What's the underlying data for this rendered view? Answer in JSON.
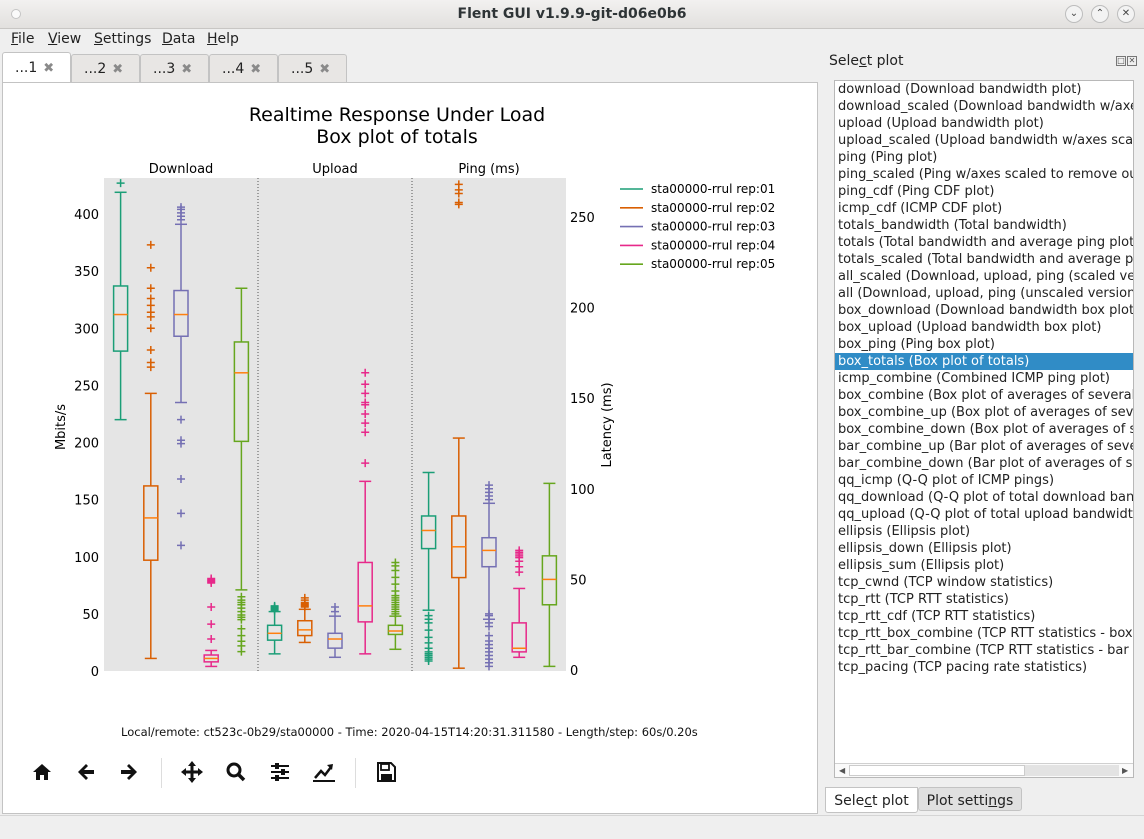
{
  "window": {
    "title": "Flent GUI v1.9.9-git-d06e0b6",
    "controls": [
      "minimize",
      "maximize",
      "close"
    ]
  },
  "menu": [
    {
      "label": "File",
      "mnemonic": "F"
    },
    {
      "label": "View",
      "mnemonic": "V"
    },
    {
      "label": "Settings",
      "mnemonic": "S"
    },
    {
      "label": "Data",
      "mnemonic": "D"
    },
    {
      "label": "Help",
      "mnemonic": "H"
    }
  ],
  "tabs": [
    {
      "label": "...1",
      "active": true
    },
    {
      "label": "...2",
      "active": false
    },
    {
      "label": "...3",
      "active": false
    },
    {
      "label": "...4",
      "active": false
    },
    {
      "label": "...5",
      "active": false
    }
  ],
  "metadata_line": "Local/remote: ct523c-0b29/sta00000 - Time: 2020-04-15T14:20:31.311580 - Length/step: 60s/0.20s",
  "toolbar": [
    {
      "name": "home",
      "icon": "home-icon"
    },
    {
      "name": "back",
      "icon": "arrow-left-icon"
    },
    {
      "name": "forward",
      "icon": "arrow-right-icon"
    },
    {
      "name": "pan",
      "icon": "move-icon"
    },
    {
      "name": "zoom",
      "icon": "magnifier-icon"
    },
    {
      "name": "configure-subplots",
      "icon": "sliders-icon"
    },
    {
      "name": "edit-axes",
      "icon": "line-chart-icon"
    },
    {
      "name": "save",
      "icon": "floppy-disk-icon"
    }
  ],
  "sidebar": {
    "title": "Select plot",
    "selected_index": 16,
    "items": [
      "download (Download bandwidth plot)",
      "download_scaled (Download bandwidth w/axes scaled to remove outliers)",
      "upload (Upload bandwidth plot)",
      "upload_scaled (Upload bandwidth w/axes scaled to remove outliers)",
      "ping (Ping plot)",
      "ping_scaled (Ping w/axes scaled to remove outliers)",
      "ping_cdf (Ping CDF plot)",
      "icmp_cdf (ICMP CDF plot)",
      "totals_bandwidth (Total bandwidth)",
      "totals (Total bandwidth and average ping plot)",
      "totals_scaled (Total bandwidth and average ping plot (scaled))",
      "all_scaled (Download, upload, ping (scaled versions))",
      "all (Download, upload, ping (unscaled versions))",
      "box_download (Download bandwidth box plot)",
      "box_upload (Upload bandwidth box plot)",
      "box_ping (Ping box plot)",
      "box_totals (Box plot of totals)",
      "icmp_combine (Combined ICMP ping plot)",
      "box_combine (Box plot of averages of several data files)",
      "box_combine_up (Box plot of averages of several data files)",
      "box_combine_down (Box plot of averages of several data files)",
      "bar_combine_up (Bar plot of averages of several data files)",
      "bar_combine_down (Bar plot of averages of several data files)",
      "qq_icmp (Q-Q plot of ICMP pings)",
      "qq_download (Q-Q plot of total download bandwidth)",
      "qq_upload (Q-Q plot of total upload bandwidth)",
      "ellipsis (Ellipsis plot)",
      "ellipsis_down (Ellipsis plot)",
      "ellipsis_sum (Ellipsis plot)",
      "tcp_cwnd (TCP window statistics)",
      "tcp_rtt (TCP RTT statistics)",
      "tcp_rtt_cdf (TCP RTT statistics)",
      "tcp_rtt_box_combine (TCP RTT statistics - box combine)",
      "tcp_rtt_bar_combine (TCP RTT statistics - bar combine)",
      "tcp_pacing (TCP pacing rate statistics)"
    ],
    "bottom_tabs": [
      {
        "label": "Select plot",
        "active": true
      },
      {
        "label": "Plot settings",
        "active": false
      }
    ]
  },
  "chart_data": {
    "type": "box",
    "title": "Realtime Response Under Load",
    "subtitle": "Box plot of totals",
    "groups": [
      "Download",
      "Upload",
      "Ping (ms)"
    ],
    "ylabel_left": "Mbits/s",
    "ylabel_right": "Latency (ms)",
    "ylim_left": [
      0,
      430
    ],
    "ylim_right": [
      0,
      270
    ],
    "yticks_left": [
      0,
      50,
      100,
      150,
      200,
      250,
      300,
      350,
      400
    ],
    "yticks_right": [
      0,
      50,
      100,
      150,
      200,
      250
    ],
    "grid": false,
    "legend_position": "right",
    "median_color": "#ff7f0e",
    "series": [
      {
        "name": "sta00000-rrul rep:01",
        "color": "#1b9e77",
        "download": {
          "wlo": 220,
          "q1": 280,
          "med": 312,
          "q3": 337,
          "whi": 419,
          "fliers": [
            427
          ]
        },
        "upload": {
          "wlo": 15,
          "q1": 27,
          "med": 33,
          "q3": 40,
          "whi": 52,
          "fliers": [
            53,
            54,
            55,
            56,
            57
          ]
        },
        "ping": {
          "wlo": 33,
          "q1": 67,
          "med": 77,
          "q3": 85,
          "whi": 109,
          "fliers": [
            5,
            6,
            7,
            8,
            9,
            10,
            12,
            15,
            18,
            22,
            26,
            28,
            30
          ]
        }
      },
      {
        "name": "sta00000-rrul rep:02",
        "color": "#d95f02",
        "download": {
          "wlo": 11,
          "q1": 97,
          "med": 134,
          "q3": 162,
          "whi": 243,
          "fliers": [
            266,
            270,
            281,
            300,
            310,
            314,
            320,
            326,
            335,
            353,
            373
          ]
        },
        "upload": {
          "wlo": 25,
          "q1": 31,
          "med": 36,
          "q3": 44,
          "whi": 54,
          "fliers": [
            56,
            57,
            58,
            59,
            60,
            62,
            64
          ]
        },
        "ping": {
          "wlo": 1,
          "q1": 51,
          "med": 68,
          "q3": 85,
          "whi": 128,
          "fliers": [
            257,
            258,
            263,
            265,
            268
          ]
        }
      },
      {
        "name": "sta00000-rrul rep:03",
        "color": "#7570b3",
        "download": {
          "wlo": 235,
          "q1": 293,
          "med": 312,
          "q3": 333,
          "whi": 391,
          "fliers": [
            110,
            138,
            168,
            199,
            202,
            220,
            395,
            398,
            401,
            404,
            406
          ]
        },
        "upload": {
          "wlo": 12,
          "q1": 20,
          "med": 28,
          "q3": 33,
          "whi": 48,
          "fliers": [
            52,
            56
          ]
        },
        "ping": {
          "wlo": 28,
          "q1": 57,
          "med": 66,
          "q3": 73,
          "whi": 92,
          "fliers": [
            2,
            4,
            6,
            8,
            10,
            12,
            14,
            16,
            19,
            24,
            26,
            28,
            30,
            31,
            94,
            96,
            98,
            100,
            102
          ]
        }
      },
      {
        "name": "sta00000-rrul rep:04",
        "color": "#e7298a",
        "download": {
          "wlo": 4,
          "q1": 8,
          "med": 11,
          "q3": 14,
          "whi": 18,
          "fliers": [
            28,
            41,
            56,
            77,
            78,
            79,
            80,
            81
          ]
        },
        "upload": {
          "wlo": 15,
          "q1": 43,
          "med": 57,
          "q3": 95,
          "whi": 166,
          "fliers": [
            182,
            209,
            217,
            225,
            233,
            235,
            243,
            251,
            261
          ]
        },
        "ping": {
          "wlo": 7,
          "q1": 10,
          "med": 12,
          "q3": 26,
          "whi": 45,
          "fliers": [
            54,
            57,
            60,
            62,
            63,
            64,
            65,
            66
          ]
        }
      },
      {
        "name": "sta00000-rrul rep:05",
        "color": "#66a61e",
        "download": {
          "wlo": 71,
          "q1": 201,
          "med": 261,
          "q3": 288,
          "whi": 335,
          "fliers": [
            17,
            22,
            26,
            31,
            37,
            45,
            47,
            49,
            52,
            55,
            58,
            60,
            62,
            65
          ]
        },
        "upload": {
          "wlo": 19,
          "q1": 32,
          "med": 35,
          "q3": 40,
          "whi": 48,
          "fliers": [
            50,
            52,
            54,
            56,
            58,
            60,
            62,
            64,
            66,
            70,
            76,
            82,
            88,
            92,
            95
          ]
        },
        "ping": {
          "wlo": 2,
          "q1": 36,
          "med": 50,
          "q3": 63,
          "whi": 103,
          "fliers": []
        }
      }
    ]
  }
}
